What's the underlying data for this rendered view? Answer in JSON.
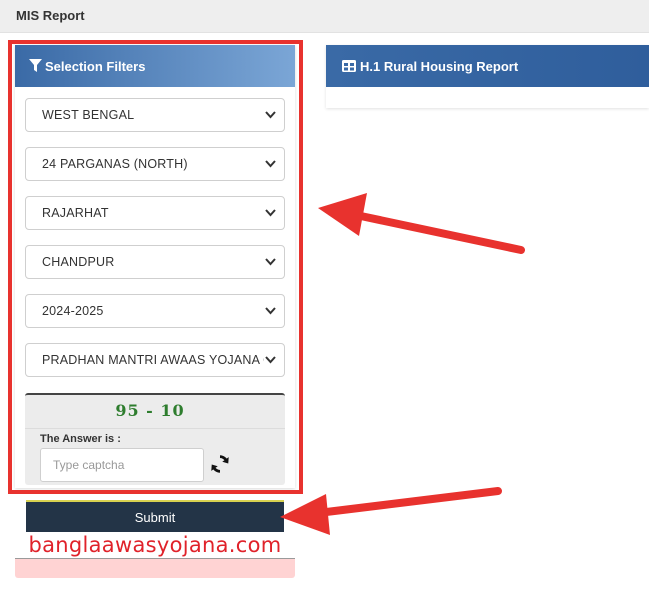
{
  "header": {
    "title": "MIS Report"
  },
  "filters": {
    "title": "Selection Filters",
    "icon": "filter-icon",
    "selects": [
      {
        "name": "state-select",
        "value": "WEST BENGAL"
      },
      {
        "name": "district-select",
        "value": "24 PARGANAS (NORTH)"
      },
      {
        "name": "block-select",
        "value": "RAJARHAT"
      },
      {
        "name": "panchayat-select",
        "value": "CHANDPUR"
      },
      {
        "name": "year-select",
        "value": "2024-2025"
      },
      {
        "name": "scheme-select",
        "value": "PRADHAN MANTRI AWAAS YOJANA G"
      }
    ],
    "captcha": {
      "question": "95 - 10",
      "answer_label": "The Answer is :",
      "placeholder": "Type captcha",
      "refresh_icon": "refresh-icon"
    },
    "submit_label": "Submit"
  },
  "report": {
    "title": "H.1 Rural Housing Report",
    "icon": "table-icon"
  },
  "watermark": "banglaawasyojana.com",
  "colors": {
    "header_blue": "#3a6aa6",
    "annotation_red": "#e8322e",
    "submit_dark": "#233447",
    "captcha_green": "#2e7d2e"
  }
}
